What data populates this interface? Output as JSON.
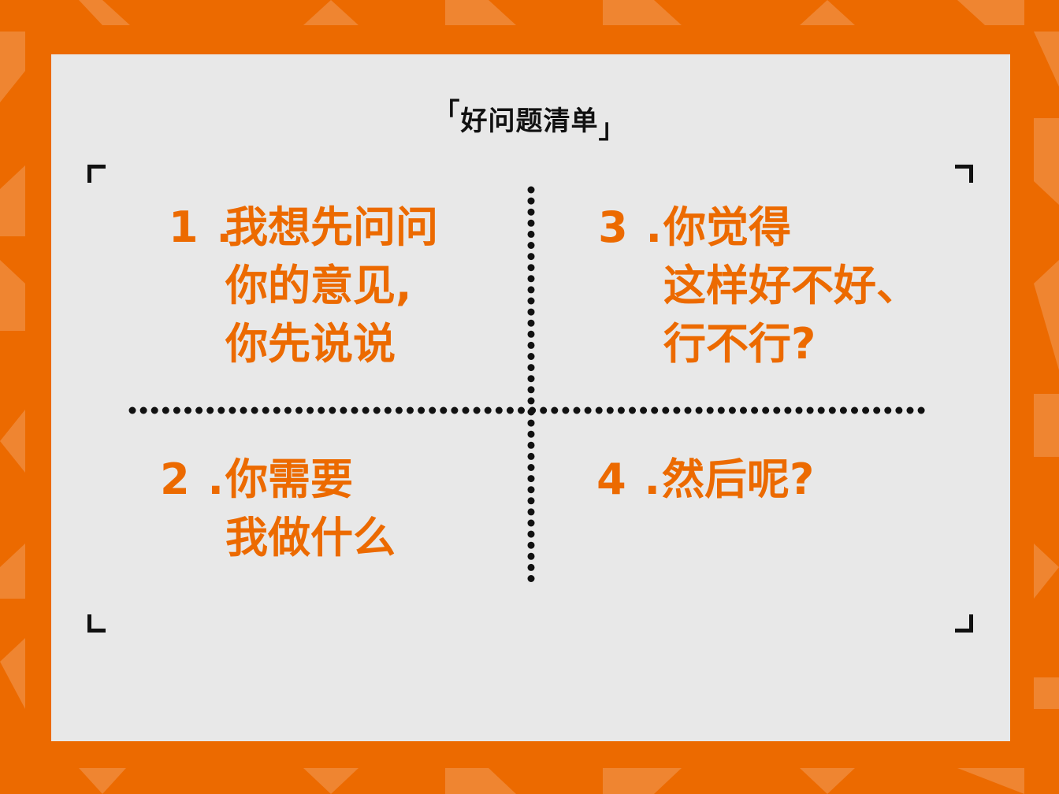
{
  "title": {
    "open_bracket": "「",
    "text": "好问题清单",
    "close_bracket": "」"
  },
  "items": [
    {
      "number": "1 .",
      "lines": [
        "我想先问问",
        "你的意见,",
        "你先说说"
      ]
    },
    {
      "number": "2 .",
      "lines": [
        "你需要",
        "我做什么"
      ]
    },
    {
      "number": "3 .",
      "lines": [
        "你觉得",
        "这样好不好、",
        "行不行?"
      ]
    },
    {
      "number": "4 .",
      "lines": [
        "然后呢?"
      ]
    }
  ],
  "colors": {
    "accent": "#EC6A00",
    "accent_light": "#F08A3A",
    "card": "#E8E8E8",
    "ink": "#111111"
  }
}
